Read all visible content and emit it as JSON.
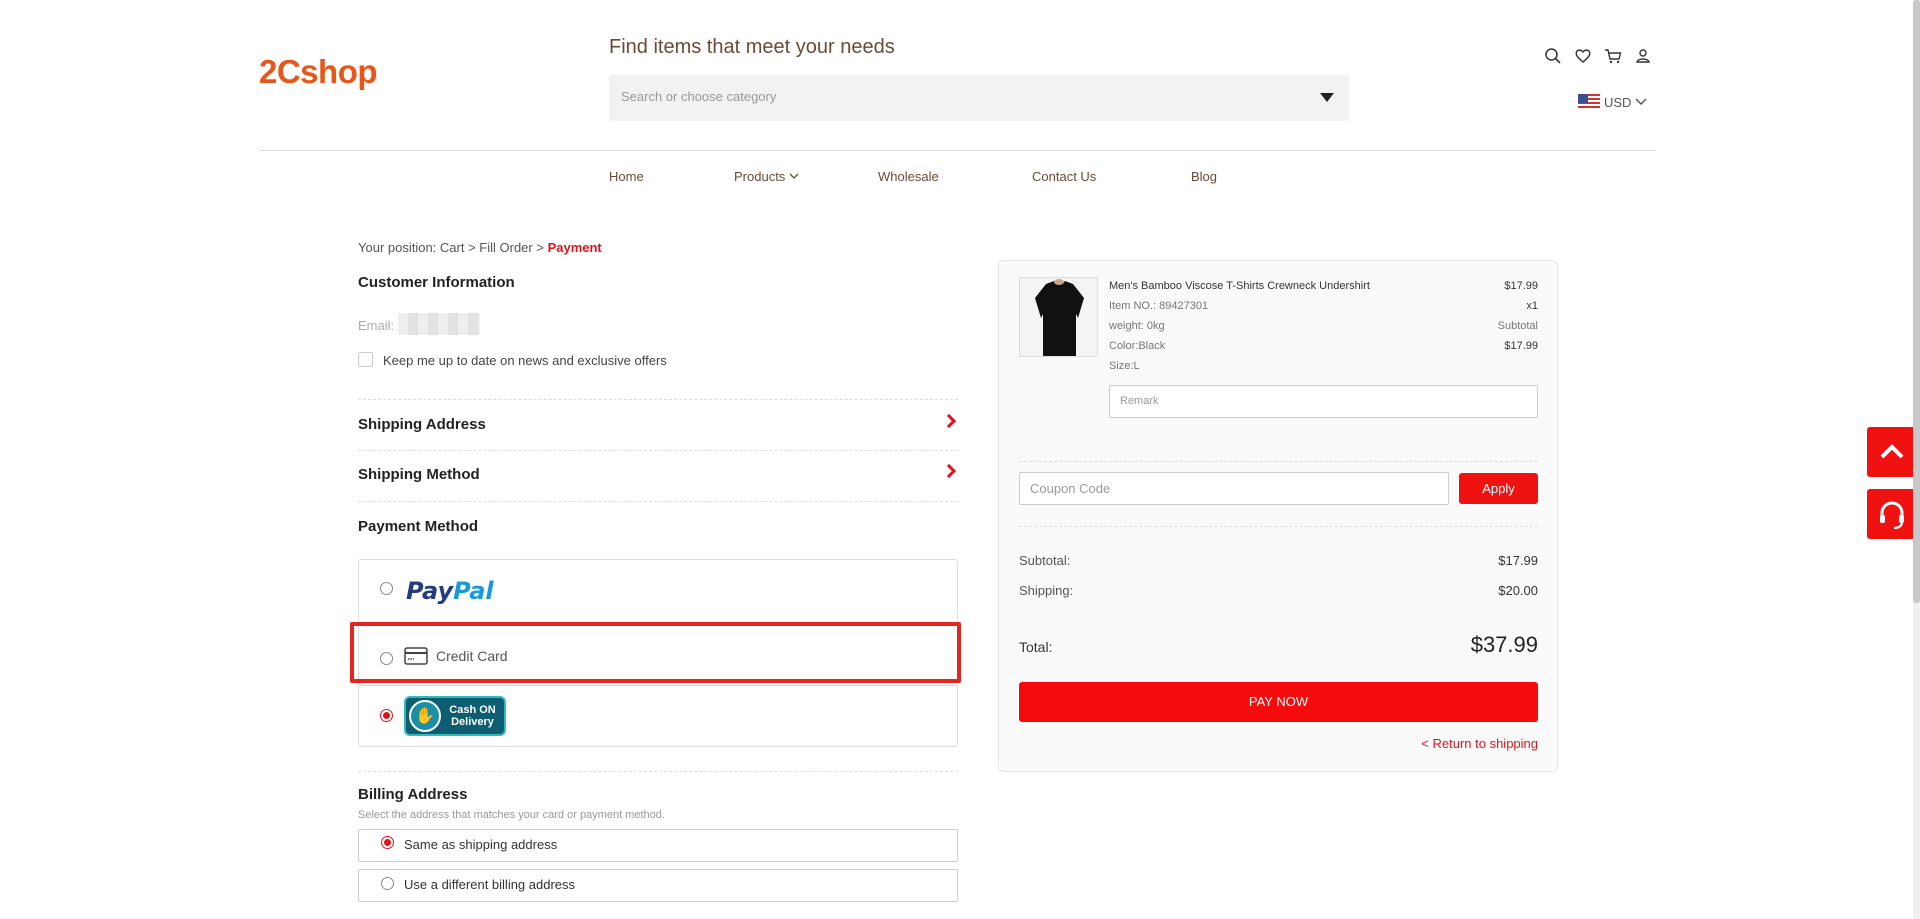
{
  "header": {
    "logo": "2Cshop",
    "tagline": "Find items that meet your needs",
    "search_placeholder": "Search or choose category",
    "currency": "USD"
  },
  "nav": [
    "Home",
    "Products",
    "Wholesale",
    "Contact Us",
    "Blog"
  ],
  "breadcrumb": {
    "prefix": "Your position: Cart > Fill Order > ",
    "current": "Payment"
  },
  "customer": {
    "title": "Customer Information",
    "email_label": "Email:",
    "newsletter": "Keep me up to date on news and exclusive offers"
  },
  "sections": {
    "shipping_address": "Shipping Address",
    "shipping_method": "Shipping Method",
    "payment_method": "Payment Method"
  },
  "payment": {
    "paypal_a": "Pay",
    "paypal_b": "Pal",
    "credit_card": "Credit Card",
    "cod_line1": "Cash ON",
    "cod_line2": "Delivery",
    "selected": "cod"
  },
  "billing": {
    "title": "Billing Address",
    "subtitle": "Select the address that matches your card or payment method.",
    "opt1": "Same as shipping address",
    "opt2": "Use a different billing address"
  },
  "order": {
    "product_name": "Men's Bamboo Viscose T-Shirts Crewneck Undershirt",
    "item_no": "Item NO.: 89427301",
    "weight": "weight: 0kg",
    "color": "Color:Black",
    "size": "Size:L",
    "price": "$17.99",
    "qty": "x1",
    "subtotal_label": "Subtotal",
    "subtotal_val": "$17.99",
    "remark_placeholder": "Remark",
    "coupon_placeholder": "Coupon Code",
    "apply": "Apply",
    "sum_subtotal_label": "Subtotal:",
    "sum_subtotal": "$17.99",
    "sum_shipping_label": "Shipping:",
    "sum_shipping": "$20.00",
    "total_label": "Total:",
    "total": "$37.99",
    "pay_now": "PAY NOW",
    "return": "< Return to shipping"
  }
}
